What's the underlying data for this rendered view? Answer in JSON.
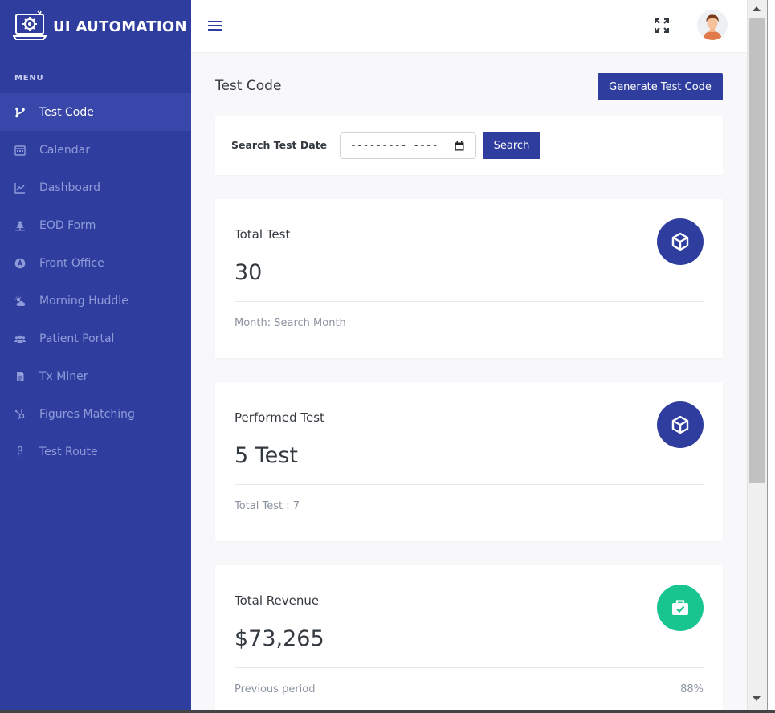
{
  "brand": {
    "name": "UI AUTOMATION",
    "logo_icon": "laptop-gear-icon"
  },
  "sidebar": {
    "menu_title": "MENU",
    "items": [
      {
        "label": "Test Code",
        "icon": "git-branch-icon",
        "active": true
      },
      {
        "label": "Calendar",
        "icon": "calendar-icon",
        "active": false
      },
      {
        "label": "Dashboard",
        "icon": "line-chart-icon",
        "active": false
      },
      {
        "label": "EOD Form",
        "icon": "tree-icon",
        "active": false
      },
      {
        "label": "Front Office",
        "icon": "letter-a-circle-icon",
        "active": false
      },
      {
        "label": "Morning Huddle",
        "icon": "sun-cloud-icon",
        "active": false
      },
      {
        "label": "Patient Portal",
        "icon": "users-icon",
        "active": false
      },
      {
        "label": "Tx Miner",
        "icon": "file-icon",
        "active": false
      },
      {
        "label": "Figures Matching",
        "icon": "hubspot-icon",
        "active": false
      },
      {
        "label": "Test Route",
        "icon": "beta-icon",
        "glyph": "β",
        "active": false
      }
    ]
  },
  "topbar": {
    "menu_icon": "hamburger-icon",
    "fullscreen_icon": "fullscreen-icon",
    "avatar_icon": "user-avatar"
  },
  "page": {
    "title": "Test Code",
    "generate_button": "Generate Test Code"
  },
  "search": {
    "label": "Search Test Date",
    "date_value": "--------- ----",
    "button": "Search"
  },
  "cards": [
    {
      "title": "Total Test",
      "value": "30",
      "footer": "Month: Search Month",
      "footer_right": "",
      "icon": "cube-icon",
      "icon_color": "#2f3e9e"
    },
    {
      "title": "Performed Test",
      "value": "5 Test",
      "footer": "Total Test : 7",
      "footer_right": "",
      "icon": "cube-icon",
      "icon_color": "#2f3e9e"
    },
    {
      "title": "Total Revenue",
      "value": "$73,265",
      "footer": "Previous period",
      "footer_right": "88%",
      "icon": "briefcase-check-icon",
      "icon_color": "#18c58f"
    }
  ],
  "colors": {
    "primary": "#2f3e9e",
    "sidebar": "#2f3e9e",
    "success": "#18c58f"
  }
}
